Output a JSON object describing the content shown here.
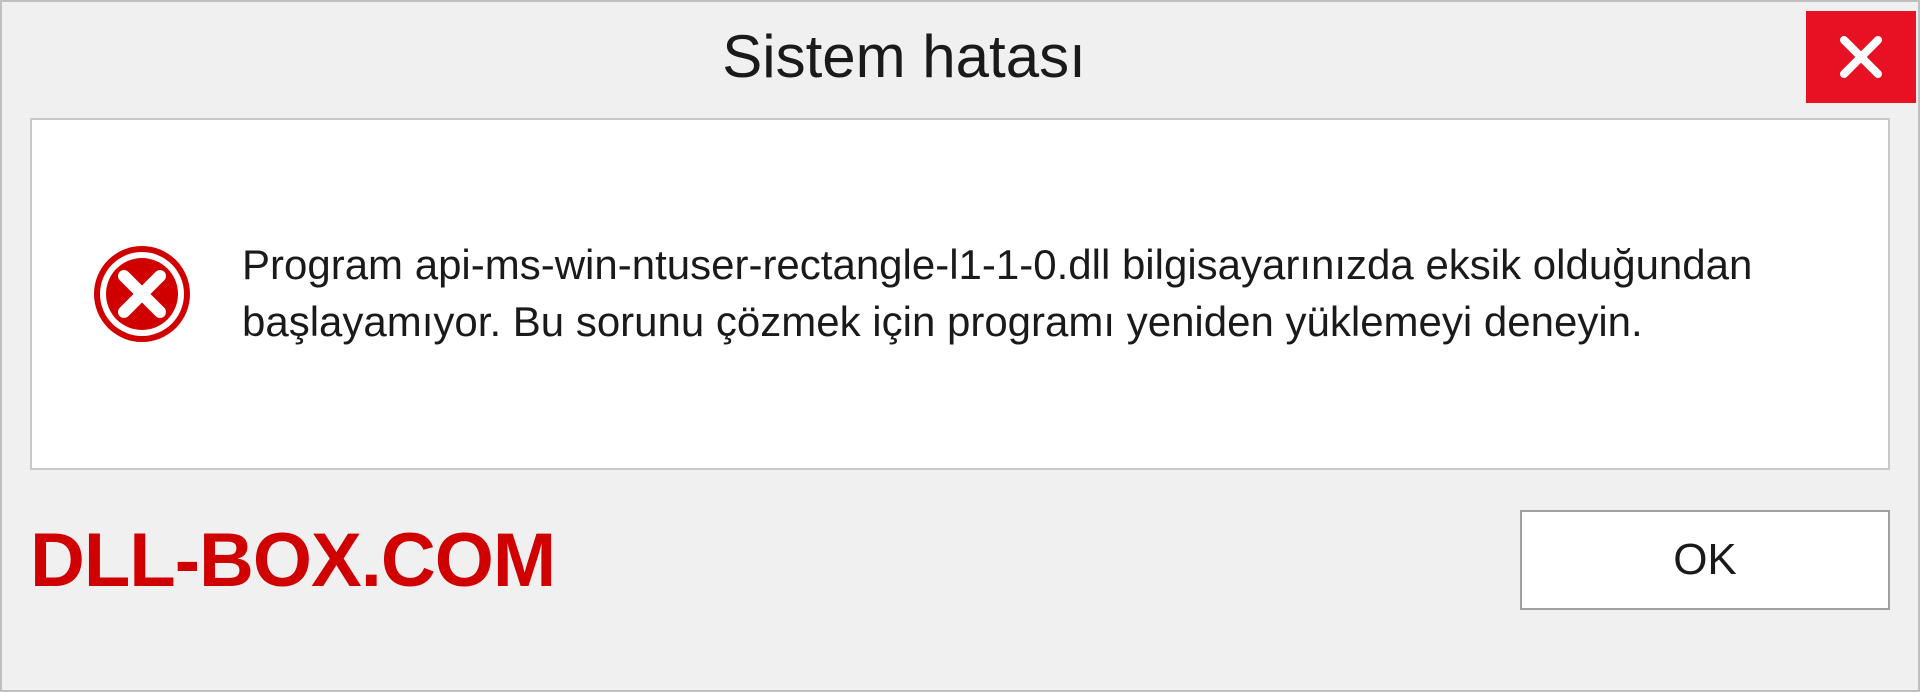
{
  "titlebar": {
    "title": "Sistem hatası"
  },
  "message": {
    "text": "Program api-ms-win-ntuser-rectangle-l1-1-0.dll bilgisayarınızda eksik olduğundan başlayamıyor. Bu sorunu çözmek için programı yeniden yüklemeyi deneyin."
  },
  "footer": {
    "watermark": "DLL-BOX.COM",
    "ok_label": "OK"
  },
  "colors": {
    "close_bg": "#e81123",
    "error_red": "#d10000",
    "watermark_red": "#d10000"
  }
}
